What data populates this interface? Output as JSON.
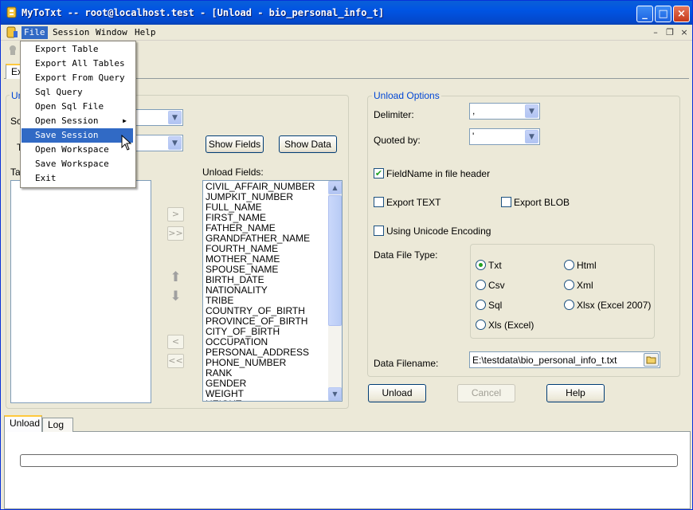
{
  "window": {
    "title": "MyToTxt -- root@localhost.test - [Unload - bio_personal_info_t]",
    "controls": {
      "minimize": "_",
      "maximize": "□",
      "close": "×"
    }
  },
  "menubar": {
    "items": [
      "File",
      "Session",
      "Window",
      "Help"
    ],
    "mdi_controls": {
      "minimize": "–",
      "restore": "❐",
      "close": "×"
    }
  },
  "file_menu": {
    "items": [
      {
        "label": "Export Table"
      },
      {
        "label": "Export All Tables"
      },
      {
        "label": "Export From Query"
      },
      {
        "label": "Sql Query"
      },
      {
        "label": "Open Sql File"
      },
      {
        "label": "Open Session",
        "submenu": "▶"
      },
      {
        "label": "Save Session"
      },
      {
        "label": "Open Workspace"
      },
      {
        "label": "Save Workspace"
      },
      {
        "label": "Exit"
      }
    ]
  },
  "top_tab": {
    "label": "Ex"
  },
  "left_group": {
    "legend": "Un",
    "schema_label": "Sc",
    "table_label": "T",
    "tables_label": "Ta",
    "show_fields_label": "Show Fields",
    "show_data_label": "Show Data",
    "unload_fields_label": "Unload Fields:",
    "move_buttons": {
      "add": ">",
      "add_all": ">>",
      "remove": "<",
      "remove_all": "<<",
      "up": "⬆",
      "down": "⬇"
    },
    "fields": [
      "CIVIL_AFFAIR_NUMBER",
      "JUMPKIT_NUMBER",
      "FULL_NAME",
      "FIRST_NAME",
      "FATHER_NAME",
      "GRANDFATHER_NAME",
      "FOURTH_NAME",
      "MOTHER_NAME",
      "SPOUSE_NAME",
      "BIRTH_DATE",
      "NATIONALITY",
      "TRIBE",
      "COUNTRY_OF_BIRTH",
      "PROVINCE_OF_BIRTH",
      "CITY_OF_BIRTH",
      "OCCUPATION",
      "PERSONAL_ADDRESS",
      "PHONE_NUMBER",
      "RANK",
      "GENDER",
      "WEIGHT",
      "HEIGHT"
    ]
  },
  "unload_options": {
    "legend": "Unload Options",
    "delimiter_label": "Delimiter:",
    "delimiter_value": ",",
    "quoted_by_label": "Quoted by:",
    "quoted_by_value": "'",
    "fieldname_header_label": "FieldName in file header",
    "fieldname_header_checked": true,
    "export_text_label": "Export TEXT",
    "export_text_checked": false,
    "export_blob_label": "Export BLOB",
    "export_blob_checked": false,
    "unicode_label": "Using Unicode Encoding",
    "unicode_checked": false,
    "data_file_type_label": "Data File Type:",
    "file_types": [
      {
        "label": "Txt",
        "selected": true
      },
      {
        "label": "Html",
        "selected": false
      },
      {
        "label": "Csv",
        "selected": false
      },
      {
        "label": "Xml",
        "selected": false
      },
      {
        "label": "Sql",
        "selected": false
      },
      {
        "label": "Xlsx (Excel 2007)",
        "selected": false
      },
      {
        "label": "Xls (Excel)",
        "selected": false
      }
    ],
    "data_filename_label": "Data Filename:",
    "data_filename_value": "E:\\testdata\\bio_personal_info_t.txt"
  },
  "actions": {
    "unload": "Unload",
    "cancel": "Cancel",
    "help": "Help"
  },
  "bottom_tabs": [
    "Unload",
    "Log"
  ],
  "progress": {
    "fraction": 0
  },
  "colors": {
    "titlebar": "#0054e3",
    "menu_highlight": "#316ac5",
    "group_legend": "#0046d5"
  }
}
